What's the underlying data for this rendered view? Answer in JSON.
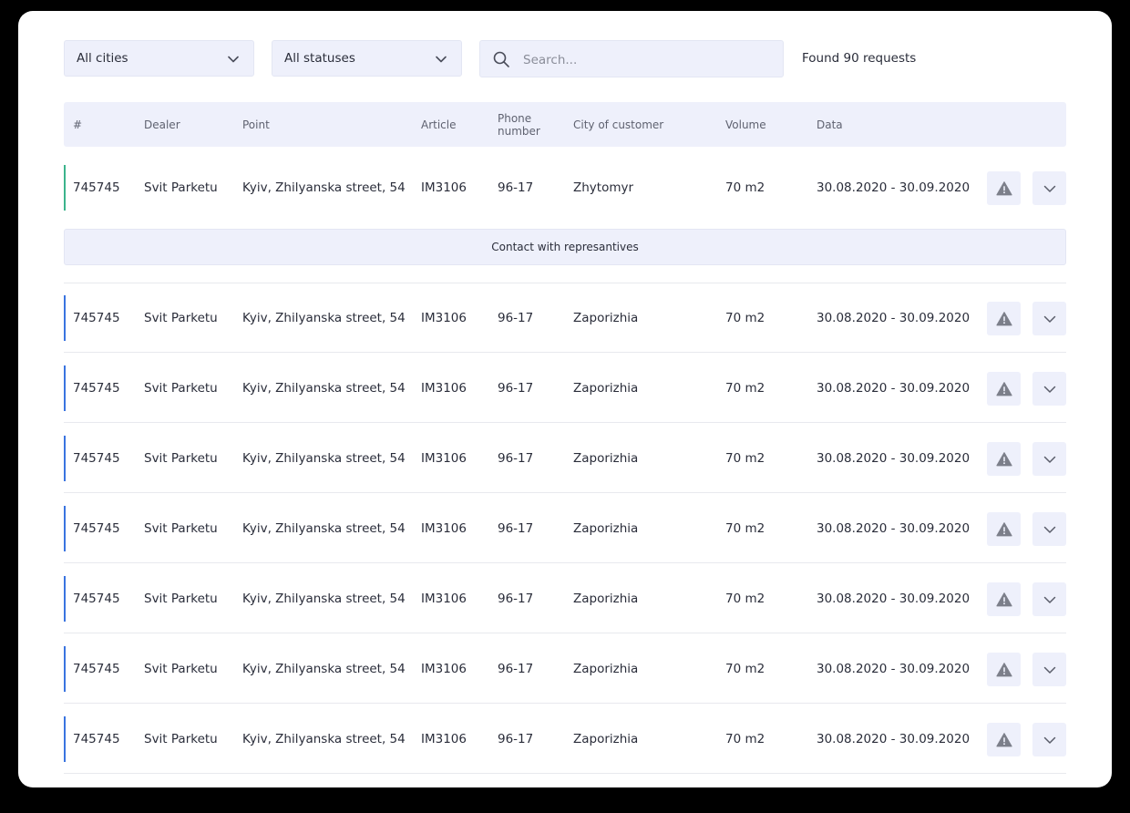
{
  "filters": {
    "city_select": "All cities",
    "status_select": "All statuses",
    "search_placeholder": "Search...",
    "found_text": "Found 90 requests"
  },
  "table": {
    "headers": {
      "id": "#",
      "dealer": "Dealer",
      "point": "Point",
      "article": "Article",
      "phone": "Phone number",
      "city": "City of customer",
      "volume": "Volume",
      "data": "Data"
    },
    "expanded_action": "Contact with represantives",
    "rows": [
      {
        "id": "745745",
        "dealer": "Svit Parketu",
        "point": "Kyiv, Zhilyanska street, 54",
        "article": "IM3106",
        "phone": "96-17",
        "city": "Zhytomyr",
        "volume": "70 m2",
        "date": "30.08.2020 - 30.09.2020",
        "accent": "#3cb48c"
      },
      {
        "id": "745745",
        "dealer": "Svit Parketu",
        "point": "Kyiv, Zhilyanska street, 54",
        "article": "IM3106",
        "phone": "96-17",
        "city": "Zaporizhia",
        "volume": "70 m2",
        "date": "30.08.2020 - 30.09.2020",
        "accent": "#3a74e0"
      },
      {
        "id": "745745",
        "dealer": "Svit Parketu",
        "point": "Kyiv, Zhilyanska street, 54",
        "article": "IM3106",
        "phone": "96-17",
        "city": "Zaporizhia",
        "volume": "70 m2",
        "date": "30.08.2020 - 30.09.2020",
        "accent": "#3a74e0"
      },
      {
        "id": "745745",
        "dealer": "Svit Parketu",
        "point": "Kyiv, Zhilyanska street, 54",
        "article": "IM3106",
        "phone": "96-17",
        "city": "Zaporizhia",
        "volume": "70 m2",
        "date": "30.08.2020 - 30.09.2020",
        "accent": "#3a74e0"
      },
      {
        "id": "745745",
        "dealer": "Svit Parketu",
        "point": "Kyiv, Zhilyanska street, 54",
        "article": "IM3106",
        "phone": "96-17",
        "city": "Zaporizhia",
        "volume": "70 m2",
        "date": "30.08.2020 - 30.09.2020",
        "accent": "#3a74e0"
      },
      {
        "id": "745745",
        "dealer": "Svit Parketu",
        "point": "Kyiv, Zhilyanska street, 54",
        "article": "IM3106",
        "phone": "96-17",
        "city": "Zaporizhia",
        "volume": "70 m2",
        "date": "30.08.2020 - 30.09.2020",
        "accent": "#3a74e0"
      },
      {
        "id": "745745",
        "dealer": "Svit Parketu",
        "point": "Kyiv, Zhilyanska street, 54",
        "article": "IM3106",
        "phone": "96-17",
        "city": "Zaporizhia",
        "volume": "70 m2",
        "date": "30.08.2020 - 30.09.2020",
        "accent": "#3a74e0"
      },
      {
        "id": "745745",
        "dealer": "Svit Parketu",
        "point": "Kyiv, Zhilyanska street, 54",
        "article": "IM3106",
        "phone": "96-17",
        "city": "Zaporizhia",
        "volume": "70 m2",
        "date": "30.08.2020 - 30.09.2020",
        "accent": "#3a74e0"
      }
    ]
  },
  "icons": {
    "row_warning": "warning-icon",
    "row_expand": "chevron-down-icon"
  },
  "colors": {
    "panel_background": "#eef0fb",
    "expanded_accent": "#3cb48c",
    "row_accent": "#3a74e0"
  }
}
